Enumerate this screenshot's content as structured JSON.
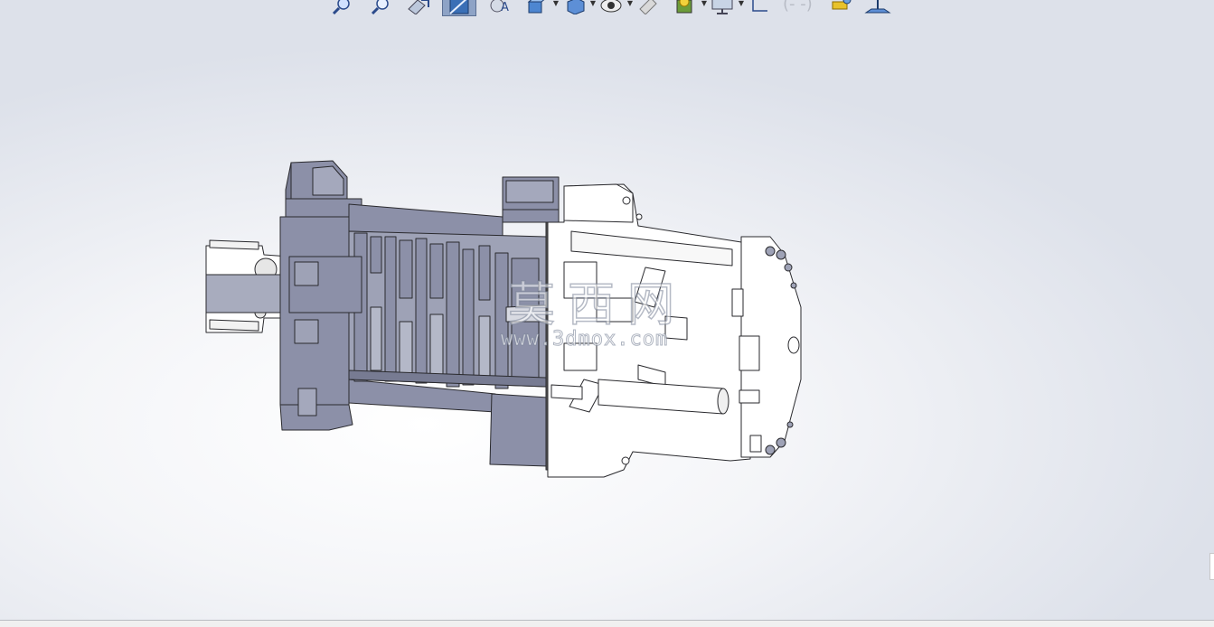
{
  "toolbar": {
    "items": [
      {
        "icon": "zoom-to-fit-icon"
      },
      {
        "icon": "zoom-to-area-icon"
      },
      {
        "icon": "previous-view-icon"
      },
      {
        "icon": "section-view-icon",
        "active": true
      },
      {
        "icon": "dynamic-annotation-icon"
      },
      {
        "icon": "view-orientation-icon",
        "dropdown": true
      },
      {
        "icon": "display-style-icon",
        "dropdown": true
      },
      {
        "icon": "hide-show-items-icon",
        "dropdown": true
      },
      {
        "icon": "edit-appearance-icon"
      },
      {
        "icon": "apply-scene-icon",
        "dropdown": true
      },
      {
        "icon": "view-settings-icon",
        "dropdown": true
      },
      {
        "icon": "sketch-icon"
      },
      {
        "icon": "brackets-icon"
      },
      {
        "icon": "measure-icon"
      },
      {
        "icon": "plane-icon"
      }
    ]
  },
  "watermark": {
    "cn": "莫西网",
    "url": "www.3dmox.com"
  },
  "colors": {
    "section_face": "#8c90a8",
    "body_white": "#ffffff",
    "edge": "#2a2a2e",
    "toolbar_active": "#8ea3c6"
  }
}
